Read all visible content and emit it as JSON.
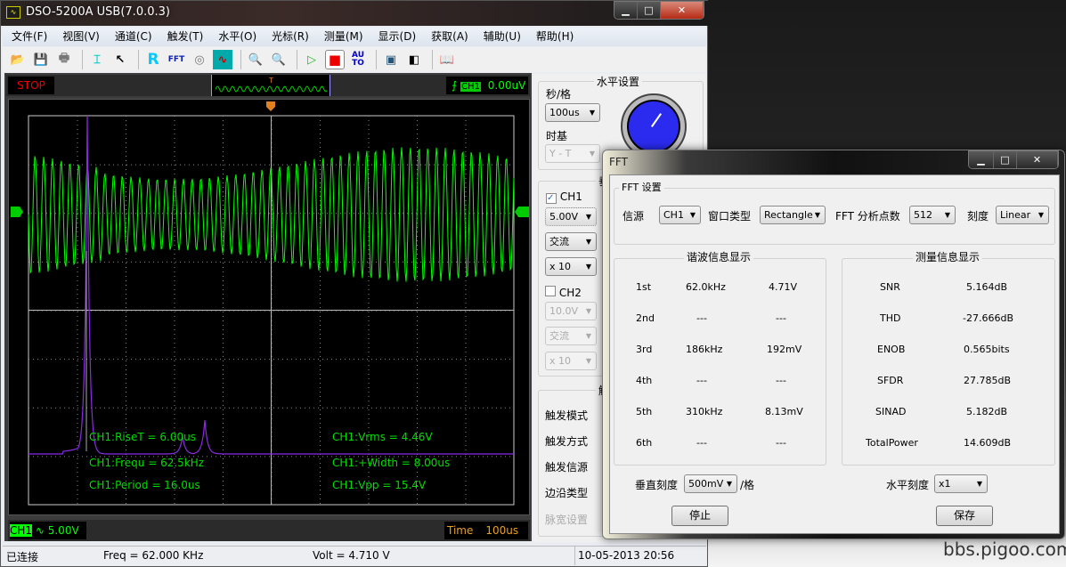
{
  "window": {
    "title": "DSO-5200A USB(7.0.0.3)",
    "app_icon": "oscilloscope-icon"
  },
  "menu": [
    "文件(F)",
    "视图(V)",
    "通道(C)",
    "触发(T)",
    "水平(O)",
    "光标(R)",
    "测量(M)",
    "显示(D)",
    "获取(A)",
    "辅助(U)",
    "帮助(H)"
  ],
  "toolbar": [
    "open-icon",
    "save-icon",
    "print-icon",
    "cursor-measure-icon",
    "pointer-icon",
    "reference-icon",
    "fft-icon",
    "record-icon",
    "display-icon",
    "zoom-out-icon",
    "zoom-in-icon",
    "run-icon",
    "stop-icon",
    "auto-icon",
    "fullscreen-icon",
    "panel-icon",
    "help-book-icon"
  ],
  "toolbar_labels": {
    "auto": "AU TO",
    "ref": "R",
    "fft": "FFT"
  },
  "scope": {
    "state": "STOP",
    "trigger_marker": "T",
    "trigger_channel": "CH1",
    "trigger_level": "0.00uV",
    "ch_label": "CH1",
    "ch_scale": "5.00V",
    "time_label": "Time",
    "time_value": "100us",
    "colors": {
      "ch1": "#00ff00",
      "fft": "#8a2be2",
      "text": "#00e000"
    }
  },
  "measurements": {
    "rise": "CH1:RiseT = 6.00us",
    "freq": "CH1:Frequ = 62.5kHz",
    "period": "CH1:Period = 16.0us",
    "vrms": "CH1:Vrms = 4.46V",
    "width": "CH1:+Width = 8.00us",
    "vpp": "CH1:Vpp = 15.4V"
  },
  "status": {
    "connection": "已连接",
    "freq": "Freq = 62.000 KHz",
    "volt": "Volt = 4.710 V",
    "datetime": "10-05-2013  20:56"
  },
  "right_panel": {
    "horizontal_title": "水平设置",
    "sec_div_label": "秒/格",
    "sec_div": "100us",
    "timebase_label": "时基",
    "timebase": "Y - T",
    "vertical_title": "垂",
    "ch1": "CH1",
    "ch1_checked": true,
    "ch1_volt": "5.00V",
    "ch1_coupling": "交流",
    "ch1_probe": "x 10",
    "ch2": "CH2",
    "ch2_checked": false,
    "ch2_volt": "10.0V",
    "ch2_coupling": "交流",
    "ch2_probe": "x 10",
    "trigger_title": "触",
    "trigger_mode": "触发模式",
    "trigger_type": "触发方式",
    "trigger_source": "触发信源",
    "edge_type": "边沿类型",
    "pulse_setting": "脉宽设置"
  },
  "fft": {
    "title": "FFT",
    "settings_title": "FFT 设置",
    "source_label": "信源",
    "source": "CH1",
    "window_label": "窗口类型",
    "window": "Rectangle",
    "points_label": "FFT 分析点数",
    "points": "512",
    "scale_label": "刻度",
    "scale": "Linear",
    "harmonics_title": "谐波信息显示",
    "harmonics": [
      {
        "n": "1st",
        "f": "62.0kHz",
        "a": "4.71V"
      },
      {
        "n": "2nd",
        "f": "---",
        "a": "---"
      },
      {
        "n": "3rd",
        "f": "186kHz",
        "a": "192mV"
      },
      {
        "n": "4th",
        "f": "---",
        "a": "---"
      },
      {
        "n": "5th",
        "f": "310kHz",
        "a": "8.13mV"
      },
      {
        "n": "6th",
        "f": "---",
        "a": "---"
      }
    ],
    "measure_title": "测量信息显示",
    "measures": [
      {
        "k": "SNR",
        "v": "5.164dB"
      },
      {
        "k": "THD",
        "v": "-27.666dB"
      },
      {
        "k": "ENOB",
        "v": "0.565bits"
      },
      {
        "k": "SFDR",
        "v": "27.785dB"
      },
      {
        "k": "SINAD",
        "v": "5.182dB"
      },
      {
        "k": "TotalPower",
        "v": "14.609dB"
      }
    ],
    "vscale_label": "垂直刻度",
    "vscale": "500mV",
    "vscale_unit": "/格",
    "hscale_label": "水平刻度",
    "hscale": "x1",
    "stop": "停止",
    "save": "保存"
  },
  "watermark": "bbs.pigoo.com"
}
